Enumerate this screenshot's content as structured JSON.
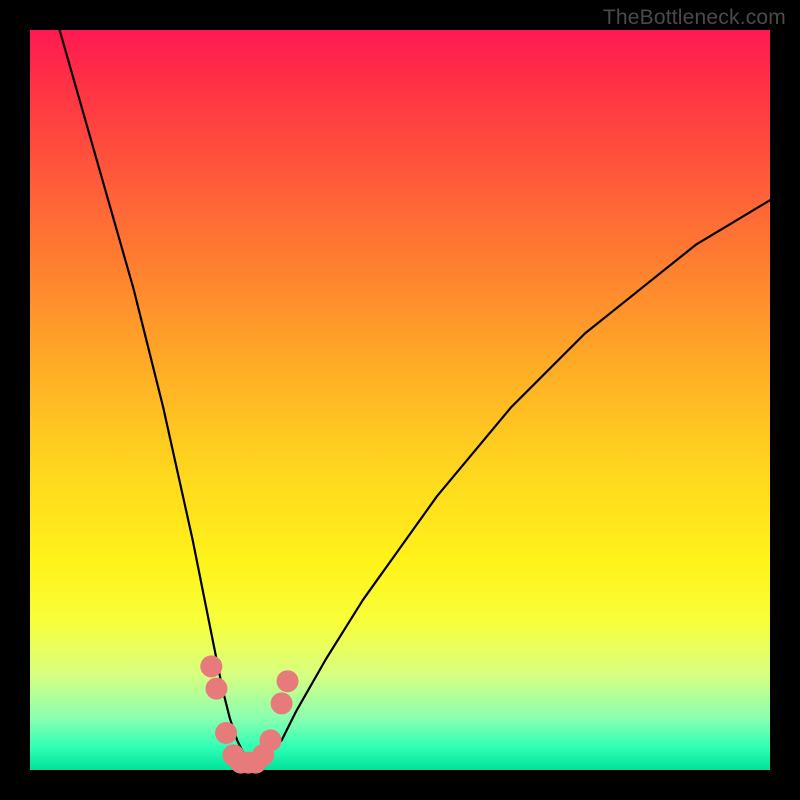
{
  "watermark": "TheBottleneck.com",
  "chart_data": {
    "type": "line",
    "title": "",
    "xlabel": "",
    "ylabel": "",
    "xlim": [
      0,
      100
    ],
    "ylim": [
      0,
      100
    ],
    "background_gradient": {
      "top": "#ff1a52",
      "upper_mid": "#ffae26",
      "mid": "#fff31a",
      "lower_mid": "#d8ff80",
      "bottom": "#00e29b"
    },
    "series": [
      {
        "name": "curve",
        "color": "#000000",
        "x": [
          4,
          6,
          8,
          10,
          12,
          14,
          16,
          18,
          20,
          22,
          24,
          25,
          26,
          27,
          28,
          29,
          30,
          31,
          32,
          34,
          36,
          40,
          45,
          50,
          55,
          60,
          65,
          70,
          75,
          80,
          85,
          90,
          95,
          100
        ],
        "y": [
          100,
          93,
          86,
          79,
          72,
          65,
          57,
          49,
          40,
          31,
          21,
          16,
          11,
          7,
          4,
          2,
          1,
          1,
          2,
          4,
          8,
          15,
          23,
          30,
          37,
          43,
          49,
          54,
          59,
          63,
          67,
          71,
          74,
          77
        ]
      }
    ],
    "markers": [
      {
        "name": "highlight-points",
        "color": "#e77b7b",
        "size": 11,
        "points": [
          {
            "x": 24.5,
            "y": 14
          },
          {
            "x": 25.2,
            "y": 11
          },
          {
            "x": 26.5,
            "y": 5
          },
          {
            "x": 27.5,
            "y": 2
          },
          {
            "x": 28.5,
            "y": 1
          },
          {
            "x": 29.5,
            "y": 1
          },
          {
            "x": 30.5,
            "y": 1
          },
          {
            "x": 31.5,
            "y": 2
          },
          {
            "x": 32.5,
            "y": 4
          },
          {
            "x": 34.0,
            "y": 9
          },
          {
            "x": 34.8,
            "y": 12
          }
        ]
      }
    ]
  }
}
